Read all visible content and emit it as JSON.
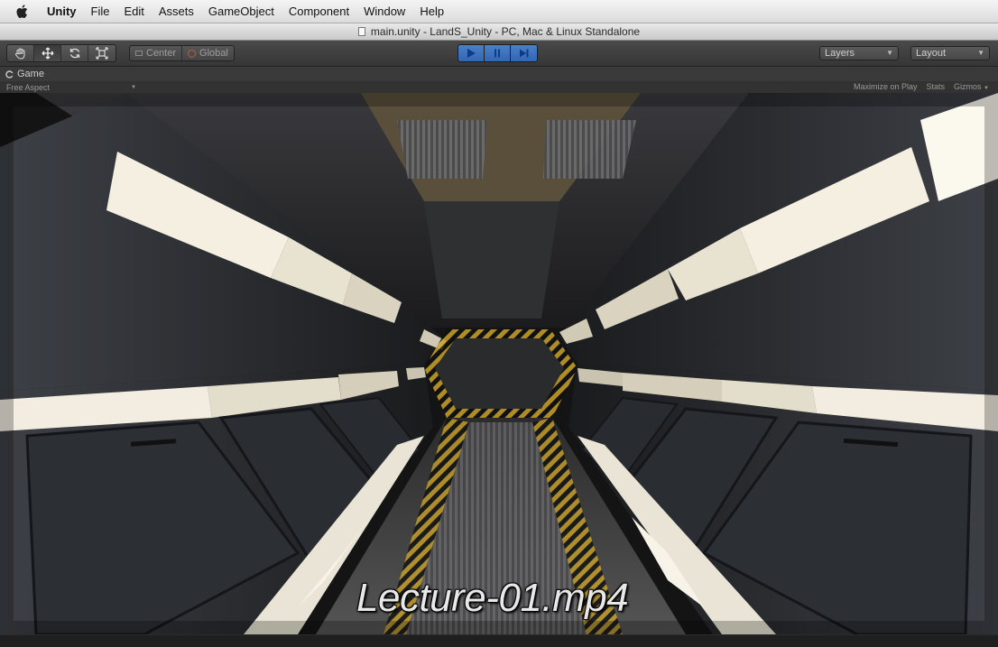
{
  "menubar": {
    "apple_icon": "apple-icon",
    "app_name": "Unity",
    "items": [
      "File",
      "Edit",
      "Assets",
      "GameObject",
      "Component",
      "Window",
      "Help"
    ]
  },
  "window": {
    "title": "main.unity - LandS_Unity - PC, Mac & Linux Standalone"
  },
  "toolbar": {
    "tools": [
      "hand-icon",
      "move-icon",
      "rotate-icon",
      "scale-icon"
    ],
    "active_tool": "move-icon",
    "pivot_mode": "Center",
    "pivot_rotation": "Global",
    "play_controls": [
      "play-icon",
      "pause-icon",
      "step-icon"
    ],
    "accent_color": "#3f74c2",
    "layers_label": "Layers",
    "layout_label": "Layout"
  },
  "game_view": {
    "tab_label": "Game",
    "aspect": "Free Aspect",
    "maximize_on_play": "Maximize on Play",
    "stats": "Stats",
    "gizmos": "Gizmos"
  },
  "video": {
    "caption": "Lecture-01.mp4"
  }
}
